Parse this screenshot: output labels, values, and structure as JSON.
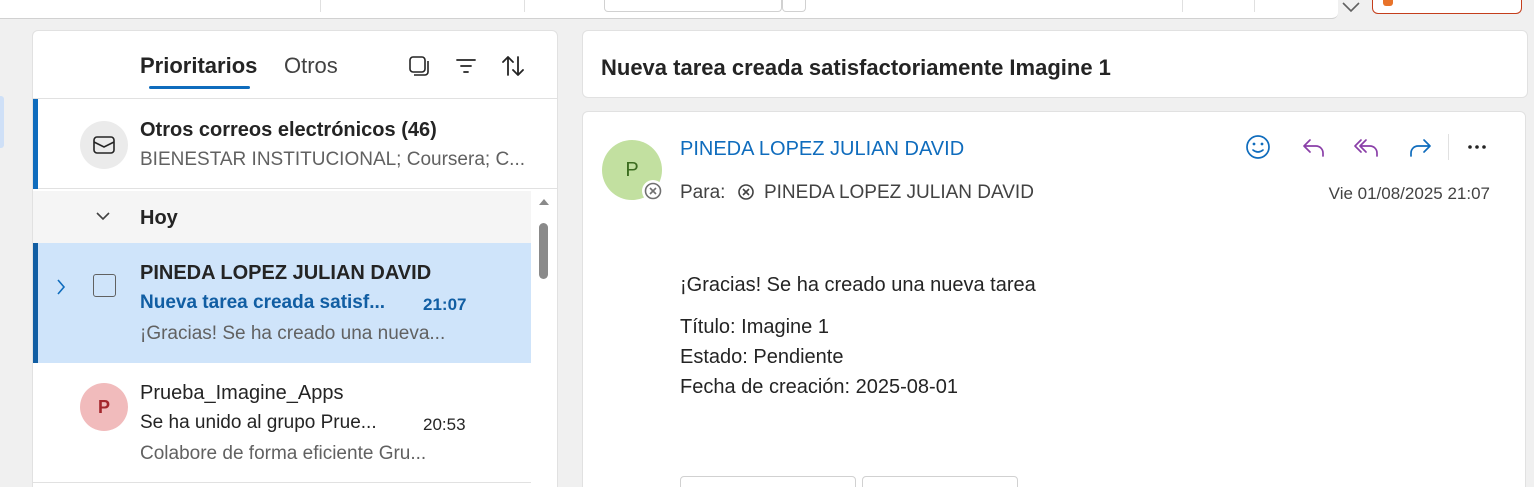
{
  "message_list": {
    "tabs": {
      "focused": "Prioritarios",
      "other": "Otros"
    },
    "other_mail": {
      "title": "Otros correos electrónicos (46)",
      "senders": "BIENESTAR INSTITUCIONAL; Coursera; C..."
    },
    "group": {
      "label": "Hoy"
    },
    "messages": [
      {
        "sender": "PINEDA LOPEZ JULIAN DAVID",
        "subject": "Nueva tarea creada satisf...",
        "time": "21:07",
        "preview": "¡Gracias! Se ha creado una nueva...",
        "selected": true
      },
      {
        "avatar_initial": "P",
        "sender": "Prueba_Imagine_Apps",
        "subject": "Se ha unido al grupo Prue...",
        "time": "20:53",
        "preview": "Colabore de forma eficiente Gru...",
        "selected": false
      }
    ]
  },
  "reading_pane": {
    "subject": "Nueva tarea creada satisfactoriamente Imagine 1",
    "from": {
      "initial": "P",
      "name": "PINEDA LOPEZ JULIAN DAVID"
    },
    "to": {
      "label": "Para:",
      "name": "PINEDA LOPEZ JULIAN DAVID"
    },
    "date": "Vie 01/08/2025 21:07",
    "body": {
      "greeting": "¡Gracias! Se ha creado una nueva tarea",
      "title_line": "Título: Imagine 1",
      "status_line": "Estado: Pendiente",
      "date_line": "Fecha de creación: 2025-08-01"
    }
  },
  "colors": {
    "accent": "#0f6cbd",
    "selected_row": "#cfe4fa",
    "reply_purple": "#8a3fa8"
  }
}
